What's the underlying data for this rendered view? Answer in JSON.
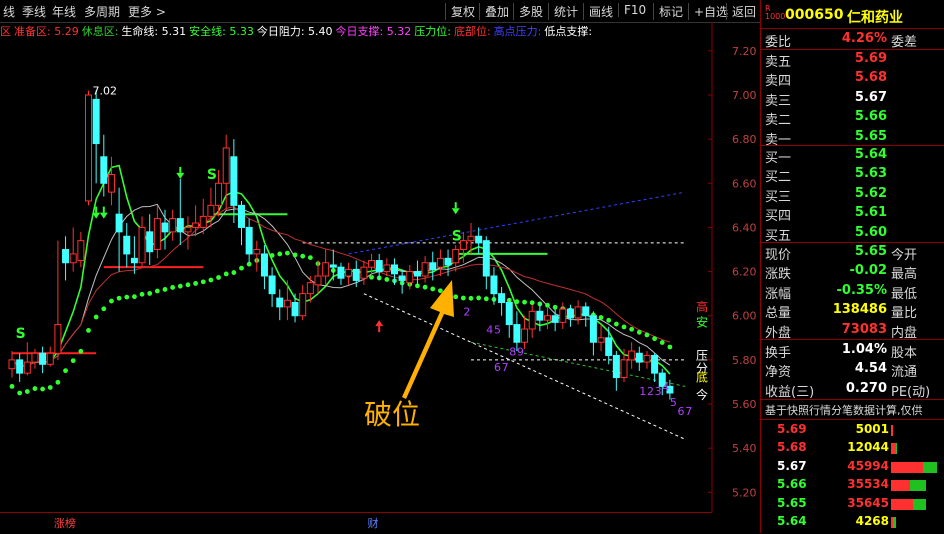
{
  "toolbar": {
    "left_items": [
      "线",
      "季线",
      "年线",
      "多周期",
      "更多 >"
    ],
    "right_items": [
      "复权",
      "叠加",
      "多股",
      "统计",
      "画线",
      "F10",
      "标记",
      "+自选",
      "返回"
    ]
  },
  "indicator_bar": [
    {
      "label": "区",
      "color": "#ff3030"
    },
    {
      "label": "准备区: 5.29",
      "color": "#ff3030"
    },
    {
      "label": "休息区:",
      "color": "#30d030"
    },
    {
      "label": "生命线: 5.31",
      "color": "#ffffff"
    },
    {
      "label": "安全线: 5.33",
      "color": "#30ff30"
    },
    {
      "label": "今日阻力: 5.40",
      "color": "#ffffff"
    },
    {
      "label": "今日支撑: 5.32",
      "color": "#ff40ff"
    },
    {
      "label": "压力位:",
      "color": "#30ff30"
    },
    {
      "label": "底部位:",
      "color": "#ff3030"
    },
    {
      "label": "高点压力:",
      "color": "#4040ff"
    },
    {
      "label": "低点支撑:",
      "color": "#ffffff"
    }
  ],
  "chart_data": {
    "type": "candlestick",
    "ylim": [
      5.12,
      7.24
    ],
    "y_ticks": [
      "7.20",
      "7.00",
      "6.80",
      "6.60",
      "6.40",
      "6.20",
      "6.00",
      "5.80",
      "5.60",
      "5.40",
      "5.20"
    ],
    "candles": [
      [
        5.76,
        5.8,
        5.72,
        5.84
      ],
      [
        5.8,
        5.74,
        5.7,
        5.83
      ],
      [
        5.74,
        5.79,
        5.73,
        5.88
      ],
      [
        5.79,
        5.83,
        5.76,
        5.85
      ],
      [
        5.83,
        5.78,
        5.74,
        5.86
      ],
      [
        5.78,
        5.83,
        5.77,
        5.86
      ],
      [
        5.83,
        5.96,
        5.8,
        6.34
      ],
      [
        6.3,
        6.24,
        6.16,
        6.36
      ],
      [
        6.24,
        6.28,
        6.2,
        6.4
      ],
      [
        6.25,
        6.34,
        6.22,
        6.38
      ],
      [
        6.52,
        7.0,
        6.5,
        7.02
      ],
      [
        6.98,
        6.78,
        6.6,
        7.02
      ],
      [
        6.72,
        6.6,
        6.54,
        6.82
      ],
      [
        6.56,
        6.64,
        6.5,
        6.72
      ],
      [
        6.46,
        6.38,
        6.2,
        6.58
      ],
      [
        6.36,
        6.28,
        6.22,
        6.42
      ],
      [
        6.26,
        6.24,
        6.19,
        6.36
      ],
      [
        6.24,
        6.4,
        6.22,
        6.45
      ],
      [
        6.38,
        6.29,
        6.23,
        6.46
      ],
      [
        6.3,
        6.44,
        6.26,
        6.5
      ],
      [
        6.42,
        6.38,
        6.3,
        6.48
      ],
      [
        6.38,
        6.44,
        6.34,
        6.48
      ],
      [
        6.44,
        6.38,
        6.32,
        6.62
      ],
      [
        6.38,
        6.4,
        6.3,
        6.45
      ],
      [
        6.4,
        6.42,
        6.36,
        6.5
      ],
      [
        6.4,
        6.45,
        6.37,
        6.53
      ],
      [
        6.45,
        6.5,
        6.4,
        6.58
      ],
      [
        6.5,
        6.6,
        6.45,
        6.66
      ],
      [
        6.6,
        6.76,
        6.48,
        6.82
      ],
      [
        6.72,
        6.5,
        6.42,
        6.8
      ],
      [
        6.5,
        6.4,
        6.32,
        6.52
      ],
      [
        6.4,
        6.28,
        6.24,
        6.44
      ],
      [
        6.28,
        6.3,
        6.2,
        6.34
      ],
      [
        6.28,
        6.18,
        6.12,
        6.32
      ],
      [
        6.18,
        6.1,
        6.04,
        6.22
      ],
      [
        6.08,
        6.04,
        5.98,
        6.12
      ],
      [
        6.04,
        6.07,
        5.98,
        6.16
      ],
      [
        6.06,
        6.0,
        5.97,
        6.1
      ],
      [
        6.0,
        6.1,
        5.98,
        6.14
      ],
      [
        6.1,
        6.15,
        6.06,
        6.18
      ],
      [
        6.14,
        6.18,
        6.1,
        6.25
      ],
      [
        6.18,
        6.24,
        6.14,
        6.3
      ],
      [
        6.23,
        6.22,
        6.16,
        6.3
      ],
      [
        6.22,
        6.17,
        6.14,
        6.24
      ],
      [
        6.18,
        6.21,
        6.14,
        6.24
      ],
      [
        6.21,
        6.16,
        6.13,
        6.25
      ],
      [
        6.17,
        6.22,
        6.14,
        6.25
      ],
      [
        6.22,
        6.25,
        6.18,
        6.28
      ],
      [
        6.25,
        6.2,
        6.16,
        6.28
      ],
      [
        6.2,
        6.23,
        6.18,
        6.26
      ],
      [
        6.23,
        6.19,
        6.14,
        6.26
      ],
      [
        6.18,
        6.16,
        6.1,
        6.21
      ],
      [
        6.15,
        6.2,
        6.12,
        6.23
      ],
      [
        6.2,
        6.18,
        6.14,
        6.25
      ],
      [
        6.18,
        6.24,
        6.15,
        6.27
      ],
      [
        6.24,
        6.21,
        6.16,
        6.29
      ],
      [
        6.22,
        6.26,
        6.18,
        6.3
      ],
      [
        6.26,
        6.23,
        6.18,
        6.3
      ],
      [
        6.24,
        6.3,
        6.2,
        6.32
      ],
      [
        6.3,
        6.34,
        6.24,
        6.38
      ],
      [
        6.34,
        6.36,
        6.28,
        6.42
      ],
      [
        6.36,
        6.33,
        6.28,
        6.4
      ],
      [
        6.34,
        6.18,
        6.12,
        6.36
      ],
      [
        6.18,
        6.1,
        6.05,
        6.22
      ],
      [
        6.1,
        6.06,
        6.0,
        6.13
      ],
      [
        6.06,
        5.96,
        5.9,
        6.08
      ],
      [
        5.96,
        5.88,
        5.84,
        6.02
      ],
      [
        5.88,
        5.94,
        5.85,
        6.0
      ],
      [
        5.94,
        6.02,
        5.9,
        6.05
      ],
      [
        6.02,
        5.98,
        5.93,
        6.06
      ],
      [
        5.98,
        6.0,
        5.94,
        6.04
      ],
      [
        6.0,
        5.97,
        5.93,
        6.03
      ],
      [
        5.97,
        6.03,
        5.94,
        6.06
      ],
      [
        6.03,
        5.99,
        5.95,
        6.05
      ],
      [
        5.99,
        6.04,
        5.96,
        6.07
      ],
      [
        6.04,
        6.0,
        5.95,
        6.06
      ],
      [
        6.0,
        5.88,
        5.82,
        6.02
      ],
      [
        5.88,
        5.9,
        5.84,
        5.96
      ],
      [
        5.9,
        5.82,
        5.78,
        5.95
      ],
      [
        5.82,
        5.72,
        5.66,
        5.84
      ],
      [
        5.72,
        5.8,
        5.7,
        5.85
      ],
      [
        5.8,
        5.84,
        5.76,
        5.88
      ],
      [
        5.83,
        5.79,
        5.75,
        5.86
      ],
      [
        5.79,
        5.82,
        5.76,
        5.84
      ],
      [
        5.82,
        5.74,
        5.7,
        5.83
      ],
      [
        5.74,
        5.68,
        5.64,
        5.76
      ],
      [
        5.68,
        5.65,
        5.62,
        5.71
      ]
    ],
    "support_line_left": [
      6.52,
      6.44,
      6.3,
      6.14,
      6.02,
      5.95,
      5.92,
      5.94,
      6.0,
      6.08,
      6.15,
      6.2,
      6.22,
      6.23,
      6.24,
      6.24,
      6.22,
      6.18,
      6.14,
      6.08,
      6.02,
      5.98,
      5.94
    ],
    "price_labels": [
      {
        "text": "7.02",
        "x": 10,
        "y": 7.02,
        "color": "#ffffff"
      },
      {
        "text": "5.20",
        "x": 90,
        "y": 5.35,
        "color": "#ffffff"
      }
    ],
    "tags": [
      {
        "text": "高",
        "y": 6.04,
        "color": "#ff3030"
      },
      {
        "text": "安",
        "y": 5.97,
        "color": "#30ff30"
      },
      {
        "text": "压",
        "y": 5.82,
        "color": "#ffffff"
      },
      {
        "text": "分",
        "y": 5.76,
        "color": "#ffffff"
      },
      {
        "text": "底",
        "y": 5.72,
        "color": "#ffff00"
      },
      {
        "text": "今",
        "y": 5.64,
        "color": "#ffffff"
      }
    ],
    "seq_numbers": [
      {
        "text": "2",
        "x": 59,
        "y": 6.0,
        "color": "#b040ff"
      },
      {
        "text": "4",
        "x": 62,
        "y": 5.92,
        "color": "#b040ff"
      },
      {
        "text": "5",
        "x": 63,
        "y": 5.92,
        "color": "#b040ff"
      },
      {
        "text": "6",
        "x": 63,
        "y": 5.75,
        "color": "#b040ff"
      },
      {
        "text": "7",
        "x": 64,
        "y": 5.75,
        "color": "#b040ff"
      },
      {
        "text": "8",
        "x": 65,
        "y": 5.82,
        "color": "#b040ff"
      },
      {
        "text": "9",
        "x": 66,
        "y": 5.82,
        "color": "#b040ff"
      },
      {
        "text": "1",
        "x": 82,
        "y": 5.64,
        "color": "#b040ff"
      },
      {
        "text": "2",
        "x": 83,
        "y": 5.64,
        "color": "#b040ff"
      },
      {
        "text": "3",
        "x": 84,
        "y": 5.64,
        "color": "#b040ff"
      },
      {
        "text": "4",
        "x": 85,
        "y": 5.66,
        "color": "#b040ff"
      },
      {
        "text": "5",
        "x": 86,
        "y": 5.59,
        "color": "#b040ff"
      },
      {
        "text": "6",
        "x": 87,
        "y": 5.55,
        "color": "#b040ff"
      },
      {
        "text": "7",
        "x": 88,
        "y": 5.55,
        "color": "#b040ff"
      }
    ],
    "s_marks": [
      {
        "x": 1,
        "y": 5.9
      },
      {
        "x": 26,
        "y": 6.62
      },
      {
        "x": 58,
        "y": 6.34
      }
    ],
    "annotation": {
      "text": "破位",
      "color": "#ffb000"
    },
    "bottom_tags": [
      {
        "text": "涨榜",
        "x": 6,
        "color": "#ff4040"
      },
      {
        "text": "财",
        "x": 47,
        "color": "#6080ff"
      }
    ]
  },
  "quote": {
    "code": "000650",
    "name": "仁和药业",
    "weibi_label": "委比",
    "weibi": "4.26%",
    "weicha_label": "委差",
    "asks": [
      {
        "label": "卖五",
        "price": "5.69",
        "color": "#ff3030"
      },
      {
        "label": "卖四",
        "price": "5.68",
        "color": "#ff3030"
      },
      {
        "label": "卖三",
        "price": "5.67",
        "color": "#ffffff"
      },
      {
        "label": "卖二",
        "price": "5.66",
        "color": "#30ff30"
      },
      {
        "label": "卖一",
        "price": "5.65",
        "color": "#30ff30"
      }
    ],
    "bids": [
      {
        "label": "买一",
        "price": "5.64",
        "color": "#30ff30"
      },
      {
        "label": "买二",
        "price": "5.63",
        "color": "#30ff30"
      },
      {
        "label": "买三",
        "price": "5.62",
        "color": "#30ff30"
      },
      {
        "label": "买四",
        "price": "5.61",
        "color": "#30ff30"
      },
      {
        "label": "买五",
        "price": "5.60",
        "color": "#30ff30"
      }
    ],
    "stats": [
      {
        "label": "现价",
        "value": "5.65",
        "right": "今开",
        "color": "#30ff30"
      },
      {
        "label": "涨跌",
        "value": "-0.02",
        "right": "最高",
        "color": "#30ff30"
      },
      {
        "label": "涨幅",
        "value": "-0.35%",
        "right": "最低",
        "color": "#30ff30"
      },
      {
        "label": "总量",
        "value": "138486",
        "right": "量比",
        "color": "#ffff00"
      },
      {
        "label": "外盘",
        "value": "73083",
        "right": "内盘",
        "color": "#ff3030"
      }
    ],
    "stats2": [
      {
        "label": "换手",
        "value": "1.04%",
        "right": "股本",
        "color": "#ffffff"
      },
      {
        "label": "净资",
        "value": "4.54",
        "right": "流通",
        "color": "#ffffff"
      },
      {
        "label": "收益(三)",
        "value": "0.270",
        "right": "PE(动)",
        "color": "#ffffff"
      }
    ],
    "note": "基于快照行情分笔数据计算,仅供",
    "ticks": [
      {
        "price": "5.69",
        "qty": "5001",
        "pcolor": "#ff3030",
        "qcolor": "#ffff00",
        "red": 0.04,
        "green": 0.0
      },
      {
        "price": "5.68",
        "qty": "12044",
        "pcolor": "#ff3030",
        "qcolor": "#ffff00",
        "red": 0.1,
        "green": 0.02
      },
      {
        "price": "5.67",
        "qty": "45994",
        "pcolor": "#ffffff",
        "qcolor": "#ff3030",
        "red": 0.6,
        "green": 0.25
      },
      {
        "price": "5.66",
        "qty": "35534",
        "pcolor": "#30ff30",
        "qcolor": "#ff3030",
        "red": 0.35,
        "green": 0.3
      },
      {
        "price": "5.65",
        "qty": "35645",
        "pcolor": "#30ff30",
        "qcolor": "#ff3030",
        "red": 0.4,
        "green": 0.25
      },
      {
        "price": "5.64",
        "qty": "4268",
        "pcolor": "#30ff30",
        "qcolor": "#ffff00",
        "red": 0.03,
        "green": 0.06
      }
    ]
  }
}
